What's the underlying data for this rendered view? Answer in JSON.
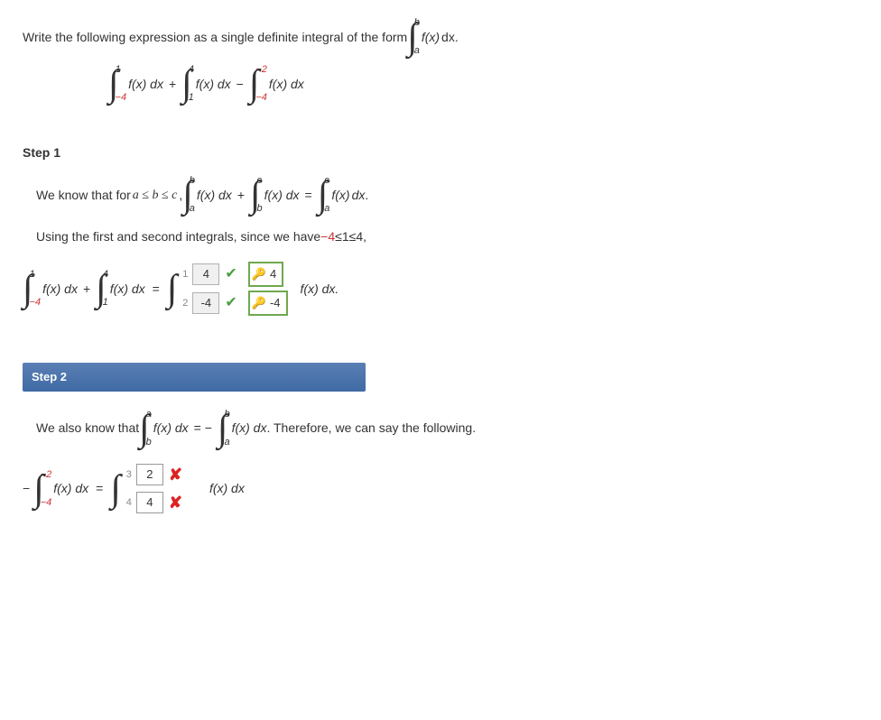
{
  "prompt": {
    "text1": "Write the following expression as a single definite integral of the form ",
    "text2": " dx."
  },
  "given_integral": {
    "int1": {
      "upper": "1",
      "lower": "−4"
    },
    "int2": {
      "upper": "4",
      "lower": "1"
    },
    "int3": {
      "upper": "−2",
      "lower": "−4"
    },
    "fx": "f(x)",
    "dx": "dx",
    "plus": "+",
    "minus": "−"
  },
  "step1": {
    "label": "Step 1",
    "line1a": "We know that for ",
    "line1b": "a ≤ b ≤ c",
    "line1c": ", ",
    "line2a": "Using the first and second integrals, since we have ",
    "line2b": "−4",
    "line2c": " ≤ ",
    "line2d": "1",
    "line2e": " ≤ ",
    "line2f": "4",
    "line2g": ",",
    "ans_upper": "4",
    "ans_lower": "-4",
    "key_upper": "4",
    "key_lower": "-4",
    "num1": "1",
    "num2": "2",
    "fx_after": "f(x) dx."
  },
  "step2": {
    "label": "Step 2",
    "line1a": "We also know that ",
    "line1b": ". Therefore, we can say the following.",
    "ans_upper": "2",
    "ans_lower": "4",
    "num3": "3",
    "num4": "4",
    "fx_after": "f(x) dx"
  },
  "sym": {
    "int_a_b": {
      "upper": "b",
      "lower": "a"
    },
    "int_a_c": {
      "upper": "c",
      "lower": "a"
    },
    "int_b_c": {
      "upper": "c",
      "lower": "b"
    },
    "int_b_a": {
      "upper": "a",
      "lower": "b"
    },
    "fx": "f(x)",
    "fxdx": "f(x) dx",
    "eq": "=",
    "plus": "+",
    "neg": "−"
  }
}
